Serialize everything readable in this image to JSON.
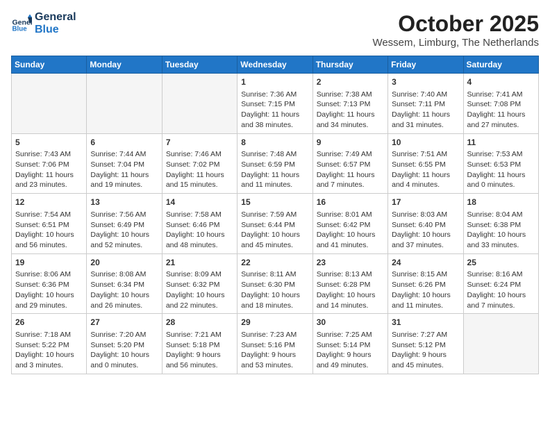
{
  "header": {
    "logo_line1": "General",
    "logo_line2": "Blue",
    "month": "October 2025",
    "location": "Wessem, Limburg, The Netherlands"
  },
  "weekdays": [
    "Sunday",
    "Monday",
    "Tuesday",
    "Wednesday",
    "Thursday",
    "Friday",
    "Saturday"
  ],
  "weeks": [
    [
      {
        "day": "",
        "empty": true
      },
      {
        "day": "",
        "empty": true
      },
      {
        "day": "",
        "empty": true
      },
      {
        "day": "1",
        "info": "Sunrise: 7:36 AM\nSunset: 7:15 PM\nDaylight: 11 hours and 38 minutes."
      },
      {
        "day": "2",
        "info": "Sunrise: 7:38 AM\nSunset: 7:13 PM\nDaylight: 11 hours and 34 minutes."
      },
      {
        "day": "3",
        "info": "Sunrise: 7:40 AM\nSunset: 7:11 PM\nDaylight: 11 hours and 31 minutes."
      },
      {
        "day": "4",
        "info": "Sunrise: 7:41 AM\nSunset: 7:08 PM\nDaylight: 11 hours and 27 minutes."
      }
    ],
    [
      {
        "day": "5",
        "info": "Sunrise: 7:43 AM\nSunset: 7:06 PM\nDaylight: 11 hours and 23 minutes."
      },
      {
        "day": "6",
        "info": "Sunrise: 7:44 AM\nSunset: 7:04 PM\nDaylight: 11 hours and 19 minutes."
      },
      {
        "day": "7",
        "info": "Sunrise: 7:46 AM\nSunset: 7:02 PM\nDaylight: 11 hours and 15 minutes."
      },
      {
        "day": "8",
        "info": "Sunrise: 7:48 AM\nSunset: 6:59 PM\nDaylight: 11 hours and 11 minutes."
      },
      {
        "day": "9",
        "info": "Sunrise: 7:49 AM\nSunset: 6:57 PM\nDaylight: 11 hours and 7 minutes."
      },
      {
        "day": "10",
        "info": "Sunrise: 7:51 AM\nSunset: 6:55 PM\nDaylight: 11 hours and 4 minutes."
      },
      {
        "day": "11",
        "info": "Sunrise: 7:53 AM\nSunset: 6:53 PM\nDaylight: 11 hours and 0 minutes."
      }
    ],
    [
      {
        "day": "12",
        "info": "Sunrise: 7:54 AM\nSunset: 6:51 PM\nDaylight: 10 hours and 56 minutes."
      },
      {
        "day": "13",
        "info": "Sunrise: 7:56 AM\nSunset: 6:49 PM\nDaylight: 10 hours and 52 minutes."
      },
      {
        "day": "14",
        "info": "Sunrise: 7:58 AM\nSunset: 6:46 PM\nDaylight: 10 hours and 48 minutes."
      },
      {
        "day": "15",
        "info": "Sunrise: 7:59 AM\nSunset: 6:44 PM\nDaylight: 10 hours and 45 minutes."
      },
      {
        "day": "16",
        "info": "Sunrise: 8:01 AM\nSunset: 6:42 PM\nDaylight: 10 hours and 41 minutes."
      },
      {
        "day": "17",
        "info": "Sunrise: 8:03 AM\nSunset: 6:40 PM\nDaylight: 10 hours and 37 minutes."
      },
      {
        "day": "18",
        "info": "Sunrise: 8:04 AM\nSunset: 6:38 PM\nDaylight: 10 hours and 33 minutes."
      }
    ],
    [
      {
        "day": "19",
        "info": "Sunrise: 8:06 AM\nSunset: 6:36 PM\nDaylight: 10 hours and 29 minutes."
      },
      {
        "day": "20",
        "info": "Sunrise: 8:08 AM\nSunset: 6:34 PM\nDaylight: 10 hours and 26 minutes."
      },
      {
        "day": "21",
        "info": "Sunrise: 8:09 AM\nSunset: 6:32 PM\nDaylight: 10 hours and 22 minutes."
      },
      {
        "day": "22",
        "info": "Sunrise: 8:11 AM\nSunset: 6:30 PM\nDaylight: 10 hours and 18 minutes."
      },
      {
        "day": "23",
        "info": "Sunrise: 8:13 AM\nSunset: 6:28 PM\nDaylight: 10 hours and 14 minutes."
      },
      {
        "day": "24",
        "info": "Sunrise: 8:15 AM\nSunset: 6:26 PM\nDaylight: 10 hours and 11 minutes."
      },
      {
        "day": "25",
        "info": "Sunrise: 8:16 AM\nSunset: 6:24 PM\nDaylight: 10 hours and 7 minutes."
      }
    ],
    [
      {
        "day": "26",
        "info": "Sunrise: 7:18 AM\nSunset: 5:22 PM\nDaylight: 10 hours and 3 minutes."
      },
      {
        "day": "27",
        "info": "Sunrise: 7:20 AM\nSunset: 5:20 PM\nDaylight: 10 hours and 0 minutes."
      },
      {
        "day": "28",
        "info": "Sunrise: 7:21 AM\nSunset: 5:18 PM\nDaylight: 9 hours and 56 minutes."
      },
      {
        "day": "29",
        "info": "Sunrise: 7:23 AM\nSunset: 5:16 PM\nDaylight: 9 hours and 53 minutes."
      },
      {
        "day": "30",
        "info": "Sunrise: 7:25 AM\nSunset: 5:14 PM\nDaylight: 9 hours and 49 minutes."
      },
      {
        "day": "31",
        "info": "Sunrise: 7:27 AM\nSunset: 5:12 PM\nDaylight: 9 hours and 45 minutes."
      },
      {
        "day": "",
        "empty": true
      }
    ]
  ]
}
